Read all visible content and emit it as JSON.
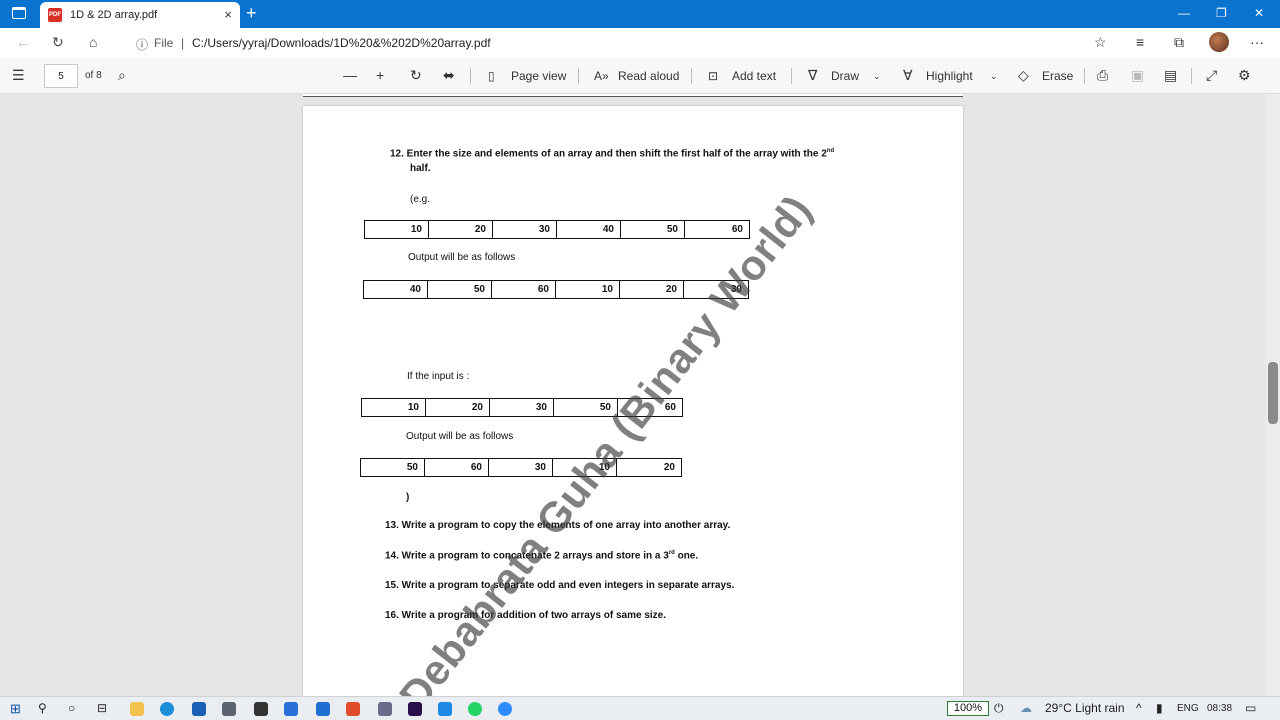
{
  "browser": {
    "tab_title": "1D & 2D array.pdf",
    "tab_close": "×",
    "new_tab": "+",
    "file_label": "File",
    "url": "C:/Users/yyraj/Downloads/1D%20&%202D%20array.pdf",
    "more": "···"
  },
  "pdf_toolbar": {
    "page_number": "5",
    "page_total": "of 8",
    "page_view": "Page view",
    "read_aloud": "Read aloud",
    "add_text": "Add text",
    "draw": "Draw",
    "highlight": "Highlight",
    "erase": "Erase"
  },
  "document": {
    "q12_line1": "12.  Enter the size and elements of an array and then shift the first half of the array with the 2",
    "q12_sup": "nd",
    "q12_line2": "half.",
    "eg": "(e.g.",
    "array1": [
      "10",
      "20",
      "30",
      "40",
      "50",
      "60"
    ],
    "output_label_1": "Output will be as follows",
    "array2": [
      "40",
      "50",
      "60",
      "10",
      "20",
      "30"
    ],
    "if_input": "If the input is :",
    "array3": [
      "10",
      "20",
      "30",
      "50",
      "60"
    ],
    "output_label_2": "Output will be as follows",
    "array4": [
      "50",
      "60",
      "30",
      "10",
      "20"
    ],
    "close_paren": ")",
    "q13": "13.  Write a program to copy the elements of one array into another array.",
    "q14_a": "14.  Write a program to concatenate 2 arrays and store in a 3",
    "q14_sup": "rd",
    "q14_b": " one.",
    "q15": "15.  Write a program to separate odd and even integers in separate arrays.",
    "q16": "16.  Write a program for addition of two arrays of same size.",
    "watermark": "Debabrata Guha (Binary World)"
  },
  "taskbar": {
    "zoom": "100%",
    "weather": "29°C  Light rain",
    "lang": "ENG",
    "time": "08:38"
  }
}
